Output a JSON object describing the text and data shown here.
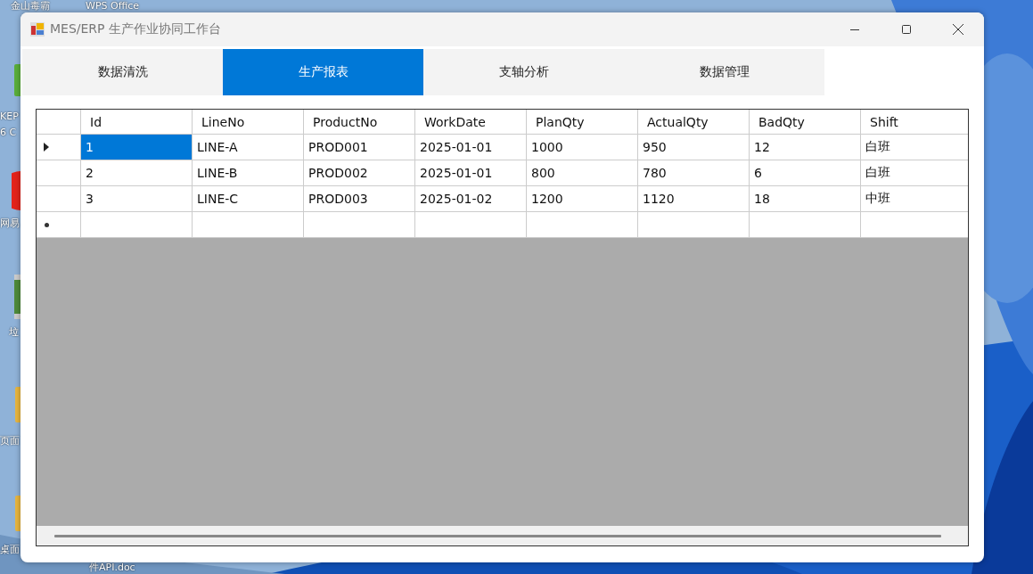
{
  "desktop": {
    "icons": [
      {
        "label": "金山毒霸",
        "kind": "none"
      },
      {
        "label": "WPS Office",
        "kind": "none"
      },
      {
        "label": "KEP",
        "kind": "green"
      },
      {
        "label": "6 C",
        "kind": "none"
      },
      {
        "label": "网易",
        "kind": "red"
      },
      {
        "label": "垃",
        "kind": "bin"
      },
      {
        "label": "页面",
        "kind": "folder"
      },
      {
        "label": "桌面",
        "kind": "folder"
      },
      {
        "label": "件API.doc",
        "kind": "none"
      }
    ]
  },
  "window": {
    "title": "MES/ERP 生产作业协同工作台"
  },
  "tabs": [
    {
      "label": "数据清洗",
      "selected": false
    },
    {
      "label": "生产报表",
      "selected": true
    },
    {
      "label": "支轴分析",
      "selected": false
    },
    {
      "label": "数据管理",
      "selected": false
    }
  ],
  "table": {
    "columns": [
      "Id",
      "LineNo",
      "ProductNo",
      "WorkDate",
      "PlanQty",
      "ActualQty",
      "BadQty",
      "Shift"
    ],
    "rows": [
      {
        "current": true,
        "cells": [
          {
            "text": "1",
            "selected": true
          },
          {
            "text": "LINE-A",
            "selected": false
          },
          {
            "text": "PROD001",
            "selected": false
          },
          {
            "text": "2025-01-01",
            "selected": false
          },
          {
            "text": "1000",
            "selected": false
          },
          {
            "text": "950",
            "selected": false
          },
          {
            "text": "12",
            "selected": false
          },
          {
            "text": "白班",
            "selected": false
          }
        ]
      },
      {
        "current": false,
        "cells": [
          {
            "text": "2",
            "selected": false
          },
          {
            "text": "LINE-B",
            "selected": false
          },
          {
            "text": "PROD002",
            "selected": false
          },
          {
            "text": "2025-01-01",
            "selected": false
          },
          {
            "text": "800",
            "selected": false
          },
          {
            "text": "780",
            "selected": false
          },
          {
            "text": "6",
            "selected": false
          },
          {
            "text": "白班",
            "selected": false
          }
        ]
      },
      {
        "current": false,
        "cells": [
          {
            "text": "3",
            "selected": false
          },
          {
            "text": "LINE-C",
            "selected": false
          },
          {
            "text": "PROD003",
            "selected": false
          },
          {
            "text": "2025-01-02",
            "selected": false
          },
          {
            "text": "1200",
            "selected": false
          },
          {
            "text": "1120",
            "selected": false
          },
          {
            "text": "18",
            "selected": false
          },
          {
            "text": "中班",
            "selected": false
          }
        ]
      }
    ],
    "new_row": true
  }
}
